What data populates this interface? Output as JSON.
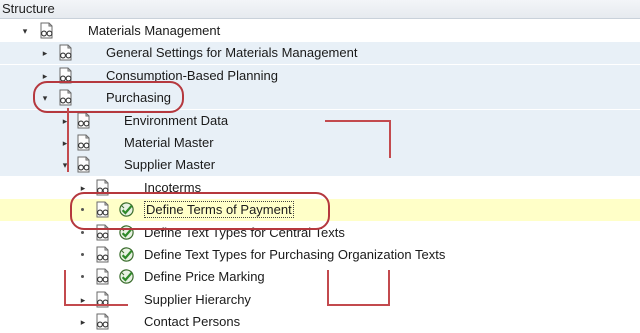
{
  "header": {
    "title": "Structure"
  },
  "tree": [
    {
      "label": "Materials Management",
      "level": 0,
      "expanded": true,
      "activity": false
    },
    {
      "label": "General Settings for Materials Management",
      "level": 1,
      "expanded": false,
      "activity": false
    },
    {
      "label": "Consumption-Based Planning",
      "level": 1,
      "expanded": false,
      "activity": false
    },
    {
      "label": "Purchasing",
      "level": 1,
      "expanded": true,
      "activity": false
    },
    {
      "label": "Environment Data",
      "level": 2,
      "expanded": false,
      "activity": false
    },
    {
      "label": "Material Master",
      "level": 2,
      "expanded": false,
      "activity": false
    },
    {
      "label": "Supplier Master",
      "level": 2,
      "expanded": true,
      "activity": false
    },
    {
      "label": "Incoterms",
      "level": 3,
      "expanded": false,
      "activity": false
    },
    {
      "label": "Define Terms of Payment",
      "level": 3,
      "expanded": null,
      "activity": true,
      "selected": true
    },
    {
      "label": "Define Text Types for Central Texts",
      "level": 3,
      "expanded": null,
      "activity": true
    },
    {
      "label": "Define Text Types for Purchasing Organization Texts",
      "level": 3,
      "expanded": null,
      "activity": true
    },
    {
      "label": "Define Price Marking",
      "level": 3,
      "expanded": null,
      "activity": true
    },
    {
      "label": "Supplier Hierarchy",
      "level": 3,
      "expanded": false,
      "activity": false
    },
    {
      "label": "Contact Persons",
      "level": 3,
      "expanded": false,
      "activity": false
    }
  ],
  "colors": {
    "annotation": "#b5383e",
    "selected_row": "#ffffc8",
    "group_band": "#e8f0f7"
  }
}
